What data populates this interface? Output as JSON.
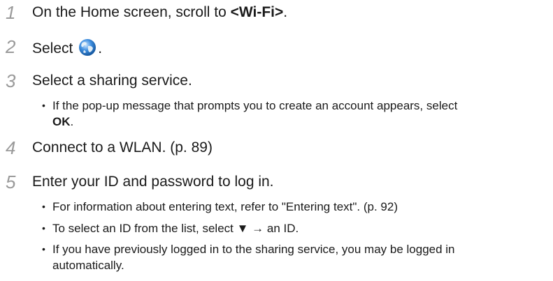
{
  "steps": [
    {
      "number": "1",
      "text_prefix": "On the Home screen, scroll to ",
      "text_bold": "<Wi-Fi>",
      "text_suffix": "."
    },
    {
      "number": "2",
      "text_prefix": "Select ",
      "icon": "globe-icon",
      "text_suffix": "."
    },
    {
      "number": "3",
      "text": "Select a sharing service.",
      "bullets": [
        {
          "line1": "If the pop-up message that prompts you to create an account appears, select",
          "line2_bold": "OK",
          "line2_suffix": "."
        }
      ]
    },
    {
      "number": "4",
      "text": "Connect to a WLAN. (p. 89)"
    },
    {
      "number": "5",
      "text": "Enter your ID and password to log in.",
      "bullets": [
        {
          "text": "For information about entering text, refer to \"Entering text\". (p. 92)"
        },
        {
          "prefix": "To select an ID from the list, select ",
          "symbol": "▼",
          "suffix": " → an ID."
        },
        {
          "line1": "If you have previously logged in to the sharing service, you may be logged in",
          "line2": "automatically."
        }
      ]
    }
  ]
}
